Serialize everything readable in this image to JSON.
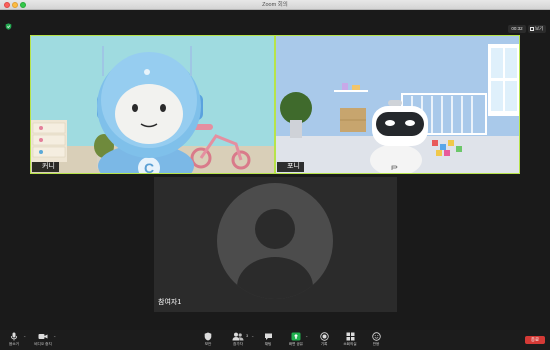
{
  "window": {
    "title": "Zoom 회의"
  },
  "header": {
    "timer": "00:32",
    "view_label": "보기"
  },
  "participants": [
    {
      "name": "커니",
      "speaking": true
    },
    {
      "name": "포니",
      "speaking": true
    },
    {
      "name": "참여자1",
      "speaking": false
    }
  ],
  "toolbar": {
    "mute_label": "음소거",
    "video_label": "비디오 중지",
    "security_label": "보안",
    "participants_label": "참가자",
    "participants_count": "3",
    "chat_label": "채팅",
    "share_label": "화면 공유",
    "record_label": "기록",
    "breakout_label": "소회의실",
    "reactions_label": "반응",
    "end_label": "종료"
  },
  "colors": {
    "active_border": "#b7e34a",
    "share_green": "#1fb04e",
    "end_red": "#d43a36",
    "bg": "#1a1a1a"
  }
}
